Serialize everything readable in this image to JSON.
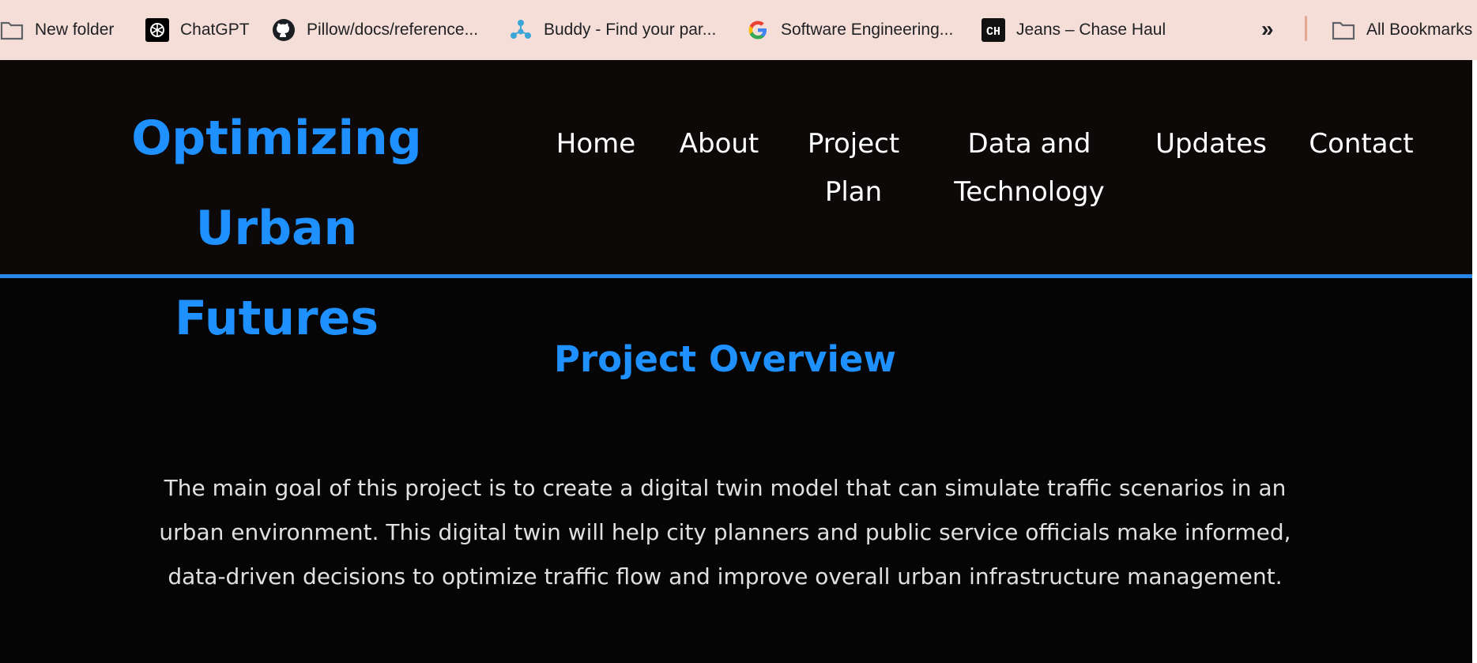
{
  "bookmarks": {
    "items": [
      {
        "label": "New folder",
        "icon": "folder-icon"
      },
      {
        "label": "ChatGPT",
        "icon": "chatgpt-icon"
      },
      {
        "label": "Pillow/docs/reference...",
        "icon": "github-icon"
      },
      {
        "label": "Buddy - Find your par...",
        "icon": "buddy-icon"
      },
      {
        "label": "Software Engineering...",
        "icon": "google-icon"
      },
      {
        "label": "Jeans – Chase Haul",
        "icon": "chase-haul-icon",
        "badge": "CH"
      }
    ],
    "all_bookmarks": "All Bookmarks"
  },
  "header": {
    "title_line1": "Optimizing Urban",
    "title_line2": "Futures",
    "nav": {
      "home": "Home",
      "about": "About",
      "project_line1": "Project",
      "project_line2": "Plan",
      "data_line1": "Data and",
      "data_line2": "Technology",
      "updates": "Updates",
      "contact": "Contact"
    }
  },
  "overview": {
    "title": "Project Overview",
    "line1": "The main goal of this project is to create a digital twin model that can simulate traffic scenarios in an",
    "line2": "urban environment. This digital twin will help city planners and public service officials make informed,",
    "line3": "data-driven decisions to optimize traffic flow and improve overall urban infrastructure management."
  },
  "colors": {
    "accent": "#1e90ff",
    "header_bg": "#0d0909",
    "page_bg": "#050505",
    "bookmarks_bg": "#f5ded8"
  }
}
